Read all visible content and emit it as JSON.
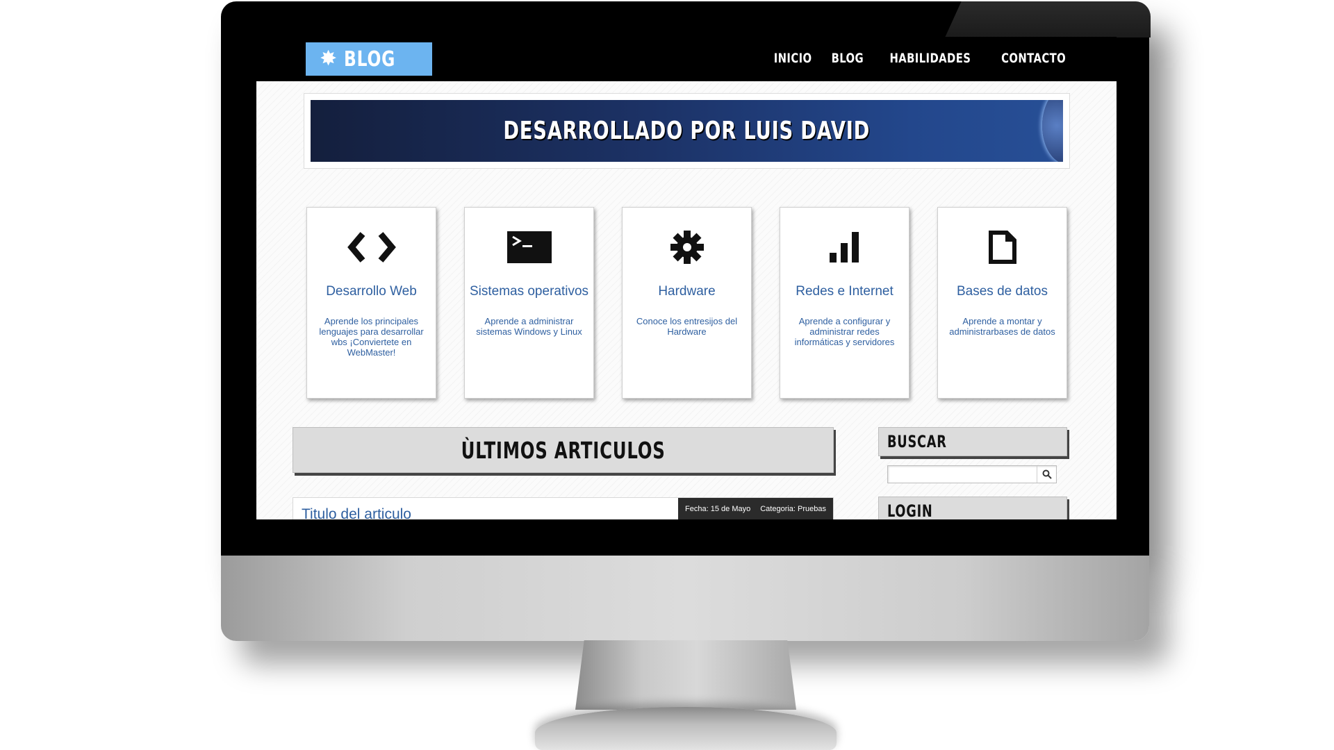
{
  "logo": {
    "text": "BLOG",
    "icon": "gear-icon"
  },
  "nav": [
    "INICIO",
    "BLOG",
    "HABILIDADES",
    "CONTACTO"
  ],
  "hero": {
    "title": "DESARROLLADO POR LUIS DAVID"
  },
  "cards": [
    {
      "icon": "code-icon",
      "title": "Desarrollo Web",
      "description": "Aprende los principales lenguajes para desarrollar wbs ¡Conviertete en WebMaster!"
    },
    {
      "icon": "terminal-icon",
      "title": "Sistemas operativos",
      "description": "Aprende a administrar sistemas Windows y Linux"
    },
    {
      "icon": "gear-icon",
      "title": "Hardware",
      "description": "Conoce los entresijos del Hardware"
    },
    {
      "icon": "signal-bars-icon",
      "title": "Redes e Internet",
      "description": "Aprende a configurar y administrar redes informáticas y servidores"
    },
    {
      "icon": "document-icon",
      "title": "Bases de datos",
      "description": "Aprende a montar y administrarbases de datos"
    }
  ],
  "articles": {
    "heading": "ÙLTIMOS ARTICULOS",
    "items": [
      {
        "title": "Titulo del articulo",
        "date": "Fecha: 15 de Mayo",
        "category": "Categoria: Pruebas"
      }
    ]
  },
  "sidebar": {
    "search_heading": "BUSCAR",
    "search_value": "",
    "login_heading": "LOGIN"
  },
  "colors": {
    "logo_bg": "#6cb4f0",
    "link_blue": "#2e5fa0",
    "topbar": "#000000"
  }
}
